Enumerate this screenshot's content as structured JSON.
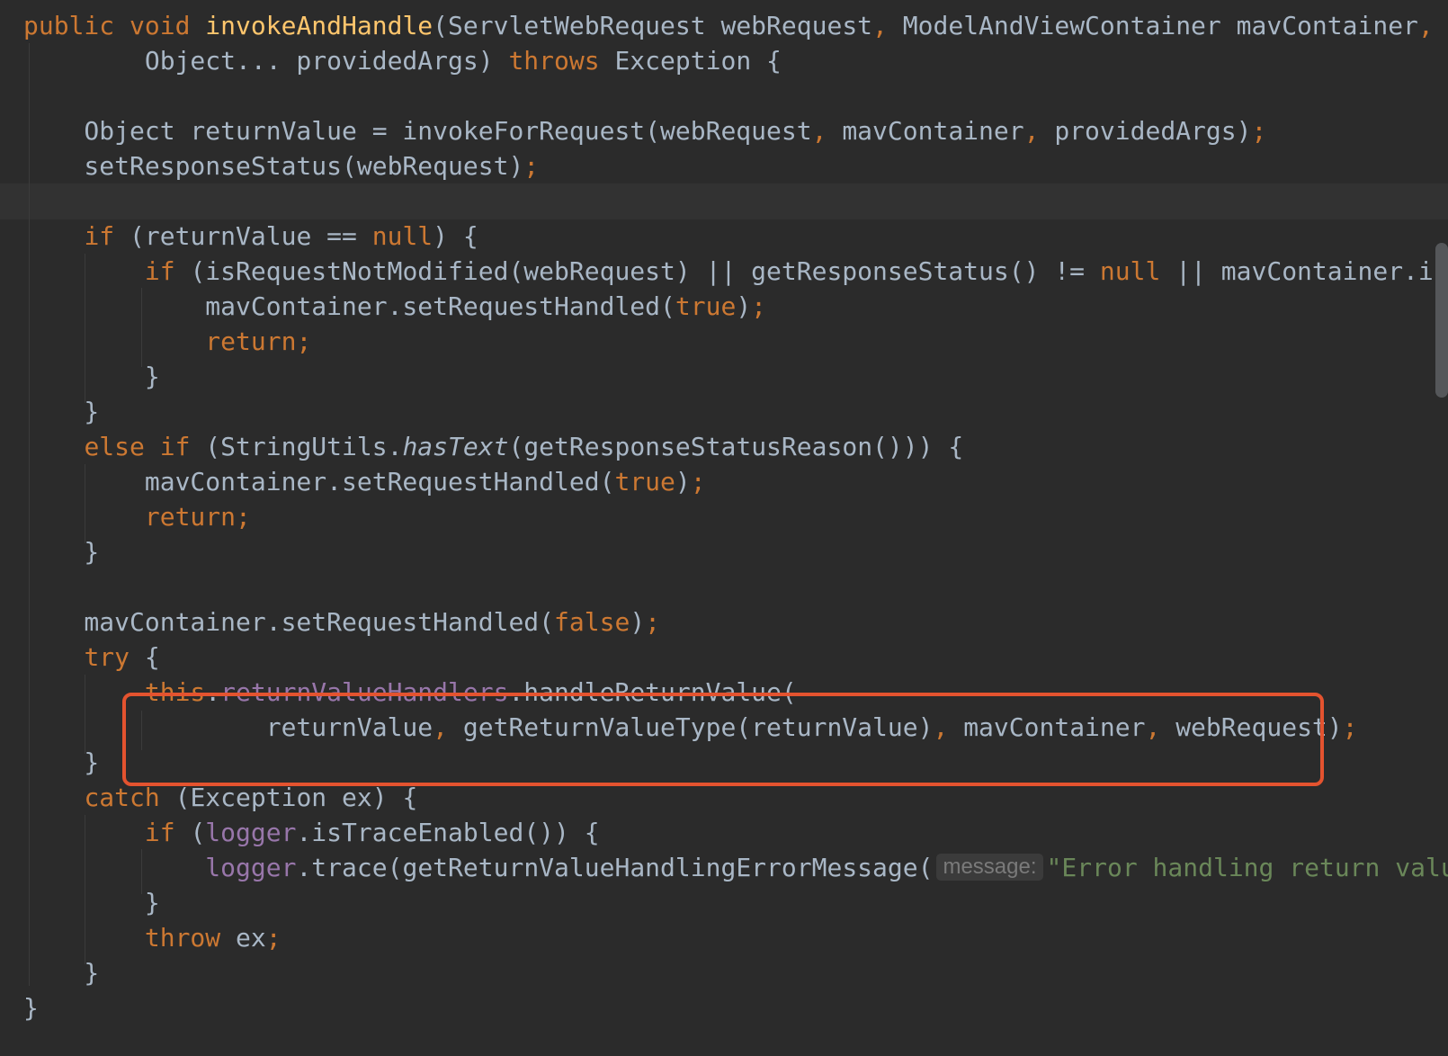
{
  "editor": {
    "lines": [
      [
        [
          "kw",
          "public void "
        ],
        [
          "fn",
          "invokeAndHandle"
        ],
        [
          "t",
          "(ServletWebRequest webRequest"
        ],
        [
          "kw",
          ", "
        ],
        [
          "t",
          "ModelAndViewContainer mavContainer"
        ],
        [
          "kw",
          ","
        ]
      ],
      [
        [
          "t",
          "        Object... providedArgs) "
        ],
        [
          "kw",
          "throws "
        ],
        [
          "t",
          "Exception {"
        ]
      ],
      [],
      [
        [
          "t",
          "    Object returnValue = invokeForRequest(webRequest"
        ],
        [
          "kw",
          ", "
        ],
        [
          "t",
          "mavContainer"
        ],
        [
          "kw",
          ", "
        ],
        [
          "t",
          "providedArgs)"
        ],
        [
          "kw",
          ";"
        ]
      ],
      [
        [
          "t",
          "    setResponseStatus(webRequest)"
        ],
        [
          "kw",
          ";"
        ]
      ],
      [],
      [
        [
          "t",
          "    "
        ],
        [
          "kw",
          "if "
        ],
        [
          "t",
          "(returnValue == "
        ],
        [
          "kw",
          "null"
        ],
        [
          "t",
          ") {"
        ]
      ],
      [
        [
          "t",
          "        "
        ],
        [
          "kw",
          "if "
        ],
        [
          "t",
          "(isRequestNotModified(webRequest) || getResponseStatus() != "
        ],
        [
          "kw",
          "null "
        ],
        [
          "t",
          "|| mavContainer.isRequestHandled()) {"
        ]
      ],
      [
        [
          "t",
          "            mavContainer.setRequestHandled("
        ],
        [
          "kw",
          "true"
        ],
        [
          "t",
          ")"
        ],
        [
          "kw",
          ";"
        ]
      ],
      [
        [
          "t",
          "            "
        ],
        [
          "kw",
          "return;"
        ]
      ],
      [
        [
          "t",
          "        }"
        ]
      ],
      [
        [
          "t",
          "    }"
        ]
      ],
      [
        [
          "t",
          "    "
        ],
        [
          "kw",
          "else if "
        ],
        [
          "t",
          "(StringUtils."
        ],
        [
          "i",
          "hasText"
        ],
        [
          "t",
          "(getResponseStatusReason())) {"
        ]
      ],
      [
        [
          "t",
          "        mavContainer.setRequestHandled("
        ],
        [
          "kw",
          "true"
        ],
        [
          "t",
          ")"
        ],
        [
          "kw",
          ";"
        ]
      ],
      [
        [
          "t",
          "        "
        ],
        [
          "kw",
          "return;"
        ]
      ],
      [
        [
          "t",
          "    }"
        ]
      ],
      [],
      [
        [
          "t",
          "    mavContainer.setRequestHandled("
        ],
        [
          "kw",
          "false"
        ],
        [
          "t",
          ")"
        ],
        [
          "kw",
          ";"
        ]
      ],
      [
        [
          "t",
          "    "
        ],
        [
          "kw",
          "try "
        ],
        [
          "t",
          "{"
        ]
      ],
      [
        [
          "t",
          "        "
        ],
        [
          "kw",
          "this"
        ],
        [
          "t",
          "."
        ],
        [
          "f",
          "returnValueHandlers"
        ],
        [
          "t",
          ".handleReturnValue("
        ]
      ],
      [
        [
          "t",
          "                returnValue"
        ],
        [
          "kw",
          ", "
        ],
        [
          "t",
          "getReturnValueType(returnValue)"
        ],
        [
          "kw",
          ", "
        ],
        [
          "t",
          "mavContainer"
        ],
        [
          "kw",
          ", "
        ],
        [
          "t",
          "webRequest)"
        ],
        [
          "kw",
          ";"
        ]
      ],
      [
        [
          "t",
          "    }"
        ]
      ],
      [
        [
          "t",
          "    "
        ],
        [
          "kw",
          "catch "
        ],
        [
          "t",
          "(Exception ex) {"
        ]
      ],
      [
        [
          "t",
          "        "
        ],
        [
          "kw",
          "if "
        ],
        [
          "t",
          "("
        ],
        [
          "f",
          "logger"
        ],
        [
          "t",
          ".isTraceEnabled()) {"
        ]
      ],
      [
        [
          "t",
          "            "
        ],
        [
          "f",
          "logger"
        ],
        [
          "t",
          ".trace(getReturnValueHandlingErrorMessage("
        ],
        [
          "h",
          "message:"
        ],
        [
          "s",
          "\"Error handling return value\""
        ],
        [
          "kw",
          ","
        ]
      ],
      [
        [
          "t",
          "        }"
        ]
      ],
      [
        [
          "t",
          "        "
        ],
        [
          "kw",
          "throw "
        ],
        [
          "t",
          "ex"
        ],
        [
          "kw",
          ";"
        ]
      ],
      [
        [
          "t",
          "    }"
        ]
      ],
      [
        [
          "t",
          "}"
        ]
      ]
    ]
  }
}
